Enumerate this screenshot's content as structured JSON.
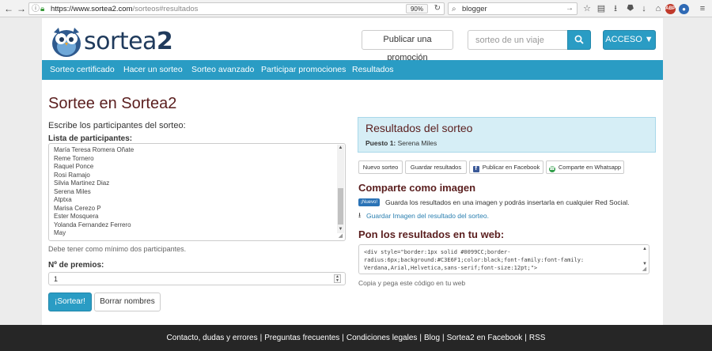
{
  "browser": {
    "url_host": "https://www.sortea2.com",
    "url_path": "/sorteos#resultados",
    "zoom": "90%",
    "search_query": "blogger"
  },
  "brand": {
    "logo_text_main": "sortea",
    "logo_text_num": "2",
    "accent_color": "#2a9cc4",
    "heading_color": "#5a1e1e"
  },
  "header": {
    "promo_button": "Publicar una promoción",
    "search_placeholder": "sorteo de un viaje",
    "search_button_icon": "search-icon",
    "access_button": "ACCESO ▼"
  },
  "nav": [
    "Sorteo certificado",
    "Hacer un sorteo",
    "Sorteo avanzado",
    "Participar promociones",
    "Resultados"
  ],
  "main": {
    "title": "Sortee en Sortea2",
    "subtitle": "Escribe los participantes del sorteo:",
    "participants_label": "Lista de participantes:",
    "participants": [
      "María Teresa Romera Oñate",
      "Reme Tornero",
      "Raquel Ponce",
      "Rosi Ramajo",
      "Silvia Martinez Diaz",
      "Serena Miles",
      "Atptxa",
      "Marisa Cerezo P",
      "Ester Mosquera",
      "Yolanda Fernandez Ferrero",
      "May"
    ],
    "min_help": "Debe tener como mínimo dos participantes.",
    "prizes_label": "Nº de premios:",
    "prizes_value": "1",
    "sortear_button": "¡Sortear!",
    "clear_button": "Borrar nombres"
  },
  "results": {
    "title": "Resultados del sorteo",
    "place_label": "Puesto 1:",
    "place_name": "Serena Miles",
    "buttons": {
      "new": "Nuevo sorteo",
      "save": "Guardar resultados",
      "facebook": "Publicar en Facebook",
      "whatsapp": "Comparte en Whatsapp"
    },
    "share_title": "Comparte como imagen",
    "new_badge": "¡Nuevo!",
    "share_text": "Guarda los resultados en una imagen y podrás insertarla en cualquier Red Social.",
    "download_link": "Guardar Imagen del resultado del sorteo.",
    "embed_title": "Pon los resultados en tu web:",
    "embed_code_lines": [
      "<div style=\"border:1px solid #0099CC;border-",
      "radius:6px;background:#C3E6F1;color:black;font-family:font-family:",
      "Verdana,Arial,Helvetica,sans-serif;font-size:12pt;\">"
    ],
    "copy_hint": "Copia y pega este código en tu web"
  },
  "footer": {
    "links": [
      "Contacto, dudas y errores",
      "Preguntas frecuentes",
      "Condiciones legales",
      "Blog",
      "Sortea2 en Facebook",
      "RSS"
    ],
    "separator": "|"
  }
}
